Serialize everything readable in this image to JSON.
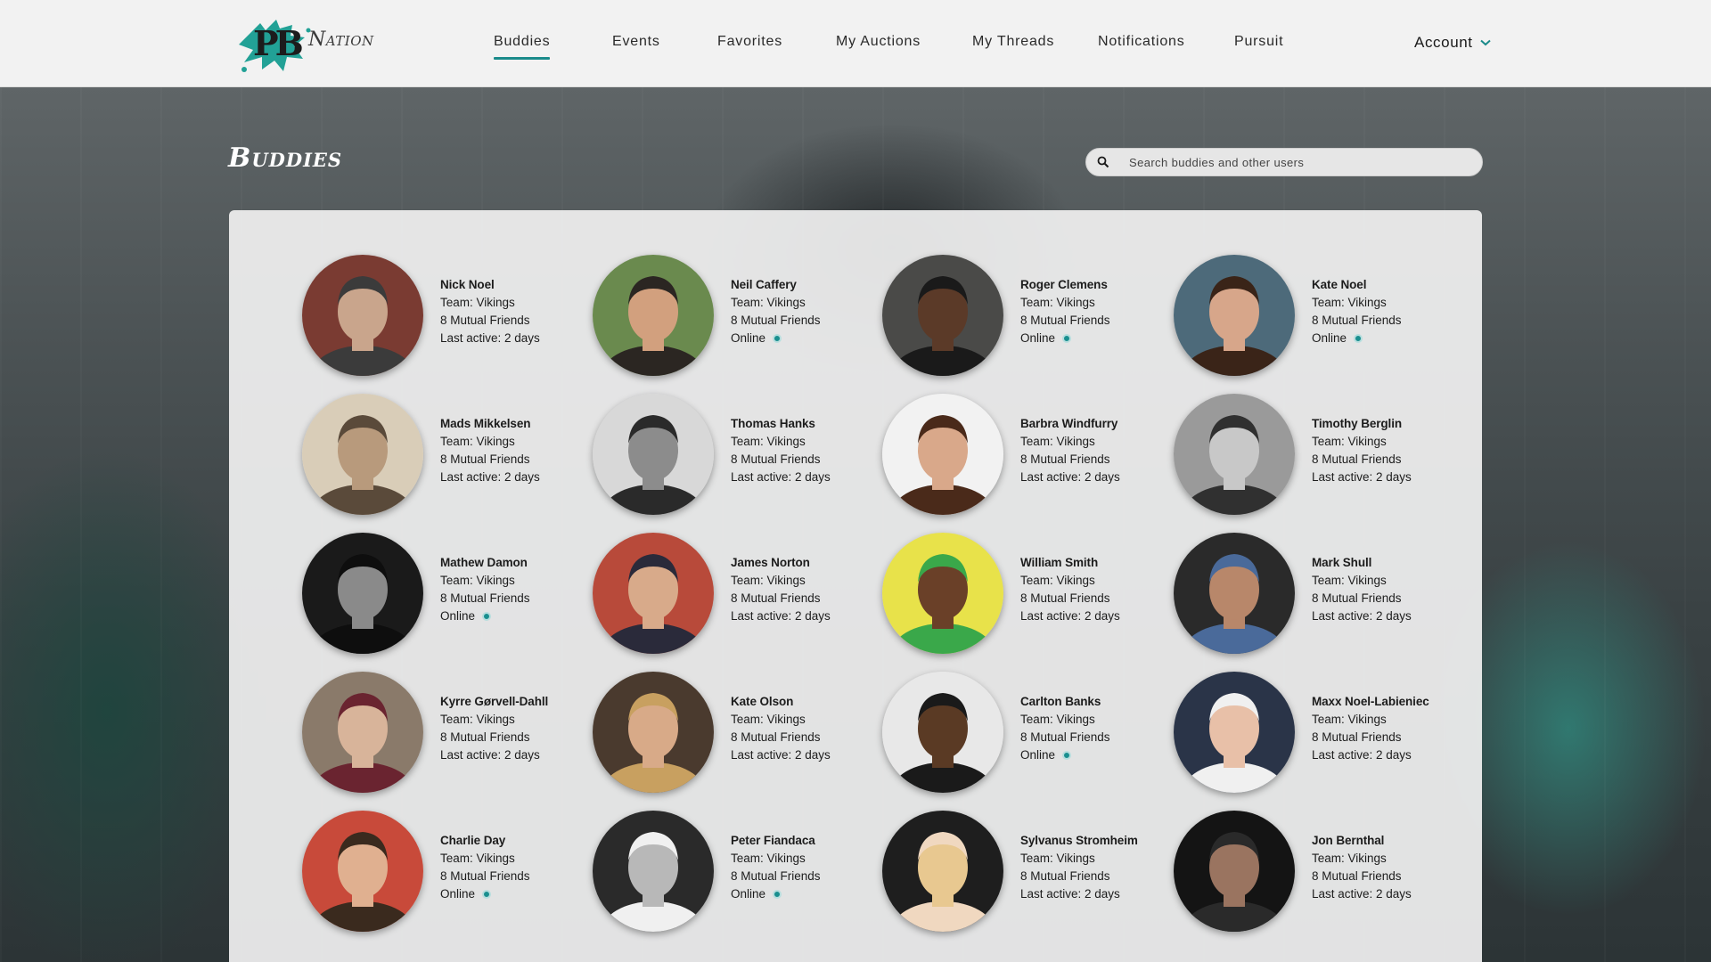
{
  "header": {
    "logo_text_pb": "PB",
    "logo_text_nation": "Nation",
    "nav": [
      {
        "label": "Buddies",
        "active": true
      },
      {
        "label": "Events",
        "active": false
      },
      {
        "label": "Favorites",
        "active": false
      },
      {
        "label": "My Auctions",
        "active": false
      },
      {
        "label": "My Threads",
        "active": false
      },
      {
        "label": "Notifications",
        "active": false
      },
      {
        "label": "Pursuit",
        "active": false
      }
    ],
    "account_label": "Account",
    "account_icon": "chevron-down-icon"
  },
  "page": {
    "title": "Buddies",
    "search": {
      "placeholder": "Search buddies and other users",
      "value": "",
      "icon": "search-icon"
    }
  },
  "colors": {
    "accent": "#1a8a8a",
    "online": "#1a8f8f"
  },
  "buddies": [
    {
      "name": "Nick Noel",
      "team": "Team: Vikings",
      "mutual": "8 Mutual Friends",
      "status": "Last active: 2 days",
      "online": false,
      "palette": [
        "#7a3b32",
        "#c9a58c",
        "#3b3b3b"
      ]
    },
    {
      "name": "Neil Caffery",
      "team": "Team: Vikings",
      "mutual": "8 Mutual Friends",
      "status": "Online",
      "online": true,
      "palette": [
        "#6a8a4e",
        "#d2a07e",
        "#2b2622"
      ]
    },
    {
      "name": "Roger Clemens",
      "team": "Team: Vikings",
      "mutual": "8 Mutual Friends",
      "status": "Online",
      "online": true,
      "palette": [
        "#4a4a48",
        "#5b3a28",
        "#1a1a1a"
      ]
    },
    {
      "name": "Kate Noel",
      "team": "Team: Vikings",
      "mutual": "8 Mutual Friends",
      "status": "Online",
      "online": true,
      "palette": [
        "#4d6a7a",
        "#d7a68a",
        "#3a2418"
      ]
    },
    {
      "name": "Mads Mikkelsen",
      "team": "Team: Vikings",
      "mutual": "8 Mutual Friends",
      "status": "Last active: 2 days",
      "online": false,
      "palette": [
        "#d9cdb8",
        "#b89a7c",
        "#5a4a3a"
      ]
    },
    {
      "name": "Thomas Hanks",
      "team": "Team: Vikings",
      "mutual": "8 Mutual Friends",
      "status": "Last active: 2 days",
      "online": false,
      "palette": [
        "#d8d8d8",
        "#8c8c8c",
        "#2a2a2a"
      ]
    },
    {
      "name": "Barbra Windfurry",
      "team": "Team: Vikings",
      "mutual": "8 Mutual Friends",
      "status": "Last active: 2 days",
      "online": false,
      "palette": [
        "#f2f2f2",
        "#d9a88a",
        "#4a2a1a"
      ]
    },
    {
      "name": "Timothy Berglin",
      "team": "Team: Vikings",
      "mutual": "8 Mutual Friends",
      "status": "Last active: 2 days",
      "online": false,
      "palette": [
        "#9a9a9a",
        "#c8c8c8",
        "#303030"
      ]
    },
    {
      "name": "Mathew Damon",
      "team": "Team: Vikings",
      "mutual": "8 Mutual Friends",
      "status": "Online",
      "online": true,
      "palette": [
        "#1a1a1a",
        "#8a8a8a",
        "#0e0e0e"
      ]
    },
    {
      "name": "James Norton",
      "team": "Team: Vikings",
      "mutual": "8 Mutual Friends",
      "status": "Last active: 2 days",
      "online": false,
      "palette": [
        "#b84a3a",
        "#d8aa8a",
        "#2a2a3a"
      ]
    },
    {
      "name": "William Smith",
      "team": "Team: Vikings",
      "mutual": "8 Mutual Friends",
      "status": "Last active: 2 days",
      "online": false,
      "palette": [
        "#e8e24a",
        "#6a4028",
        "#3aa84a"
      ]
    },
    {
      "name": "Mark Shull",
      "team": "Team: Vikings",
      "mutual": "8 Mutual Friends",
      "status": "Last active: 2 days",
      "online": false,
      "palette": [
        "#2a2a2a",
        "#b8876a",
        "#4a6a9a"
      ]
    },
    {
      "name": "Kyrre Gørvell-Dahll",
      "team": "Team: Vikings",
      "mutual": "8 Mutual Friends",
      "status": "Last active: 2 days",
      "online": false,
      "palette": [
        "#8a7a6a",
        "#d8b49a",
        "#6a2430"
      ]
    },
    {
      "name": "Kate Olson",
      "team": "Team: Vikings",
      "mutual": "8 Mutual Friends",
      "status": "Last active: 2 days",
      "online": false,
      "palette": [
        "#4a3a2e",
        "#d8aa88",
        "#c8a060"
      ]
    },
    {
      "name": "Carlton Banks",
      "team": "Team: Vikings",
      "mutual": "8 Mutual Friends",
      "status": "Online",
      "online": true,
      "palette": [
        "#e8e8e8",
        "#5a3a24",
        "#1a1a1a"
      ]
    },
    {
      "name": "Maxx Noel-Labieniec",
      "team": "Team: Vikings",
      "mutual": "8 Mutual Friends",
      "status": "Last active: 2 days",
      "online": false,
      "palette": [
        "#2a3448",
        "#e8c0a8",
        "#f0f0f0"
      ]
    },
    {
      "name": "Charlie Day",
      "team": "Team: Vikings",
      "mutual": "8 Mutual Friends",
      "status": "Online",
      "online": true,
      "palette": [
        "#c84a3a",
        "#e0b090",
        "#3a2a1e"
      ]
    },
    {
      "name": "Peter Fiandaca",
      "team": "Team: Vikings",
      "mutual": "8 Mutual Friends",
      "status": "Online",
      "online": true,
      "palette": [
        "#2a2a2a",
        "#b8b8b8",
        "#f0f0f0"
      ]
    },
    {
      "name": "Sylvanus Stromheim",
      "team": "Team: Vikings",
      "mutual": "8 Mutual Friends",
      "status": "Last active: 2 days",
      "online": false,
      "palette": [
        "#1e1e1e",
        "#e8c890",
        "#f0d8c0"
      ]
    },
    {
      "name": "Jon Bernthal",
      "team": "Team: Vikings",
      "mutual": "8 Mutual Friends",
      "status": "Last active: 2 days",
      "online": false,
      "palette": [
        "#141414",
        "#9a7460",
        "#2a2a2a"
      ]
    }
  ]
}
